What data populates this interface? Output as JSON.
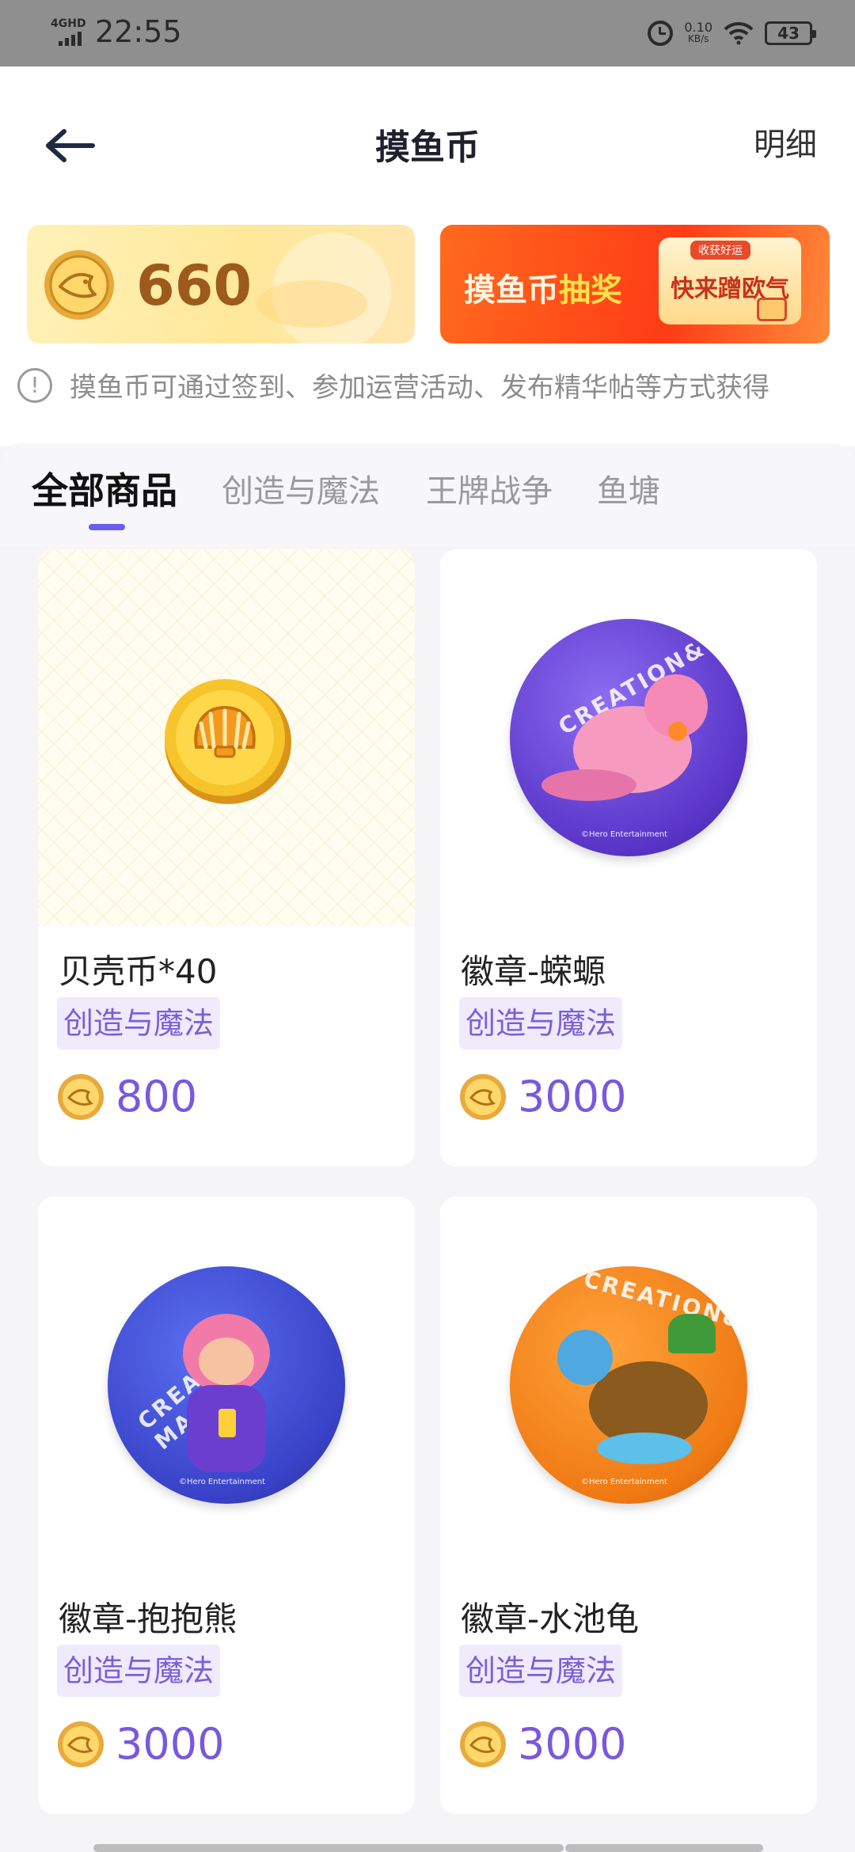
{
  "status_bar": {
    "network": "4GHD",
    "time": "22:55",
    "net_speed_value": "0.10",
    "net_speed_unit": "KB/s",
    "battery": "43"
  },
  "header": {
    "title": "摸鱼币",
    "detail_label": "明细"
  },
  "balance": {
    "value": "660"
  },
  "lottery": {
    "title_prefix": "摸鱼币",
    "title_highlight": "抽奖",
    "tag": "收获好运",
    "cta": "快来蹭欧气"
  },
  "info": {
    "text": "摸鱼币可通过签到、参加运营活动、发布精华帖等方式获得"
  },
  "tabs": [
    {
      "label": "全部商品",
      "active": true
    },
    {
      "label": "创造与魔法",
      "active": false
    },
    {
      "label": "王牌战争",
      "active": false
    },
    {
      "label": "鱼塘",
      "active": false
    }
  ],
  "products": [
    {
      "name": "贝壳币*40",
      "category": "创造与魔法",
      "price": "800",
      "image_icon": "shell-coin-icon"
    },
    {
      "name": "徽章-蝾螈",
      "category": "创造与魔法",
      "price": "3000",
      "image_icon": "axolotl-badge-icon",
      "badge_text": "CREATION&",
      "badge_credit": "©Hero Entertainment"
    },
    {
      "name": "徽章-抱抱熊",
      "category": "创造与魔法",
      "price": "3000",
      "image_icon": "bear-badge-icon",
      "badge_text": "CREATION MAGIC",
      "badge_credit": "©Hero Entertainment"
    },
    {
      "name": "徽章-水池龟",
      "category": "创造与魔法",
      "price": "3000",
      "image_icon": "turtle-badge-icon",
      "badge_text": "CREATION&M",
      "badge_credit": "©Hero Entertainment"
    }
  ],
  "colors": {
    "accent": "#6a5df0",
    "price": "#7a58dd",
    "tag_bg": "#efeafc"
  }
}
